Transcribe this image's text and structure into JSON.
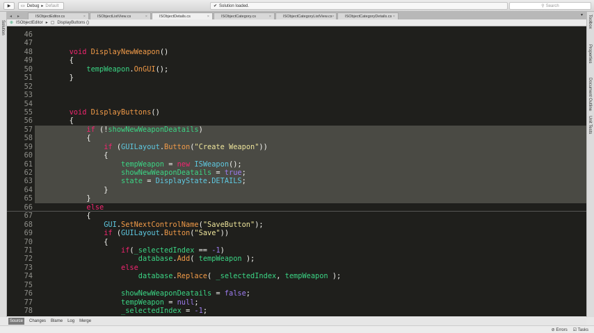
{
  "toolbar": {
    "run_icon": "play-icon",
    "config": "Debug",
    "separator": "▸",
    "target": "Default",
    "status": "Solution loaded.",
    "search_placeholder": "Search"
  },
  "tabs": [
    {
      "label": "ISObjectEditor.cs",
      "active": false
    },
    {
      "label": "ISObjectListView.cs",
      "active": false
    },
    {
      "label": "ISObjectDetails.cs",
      "active": true
    },
    {
      "label": "ISObjectCategory.cs",
      "active": false
    },
    {
      "label": "ISObjectCategoryListView.cs",
      "active": false
    },
    {
      "label": "ISObjectCategoryDetails.cs",
      "active": false
    }
  ],
  "breadcrumb": {
    "class": "ISObjectEditor",
    "sep": "▸",
    "method": "DisplayButtons ()"
  },
  "left_pad": {
    "solution": "Solution"
  },
  "right_pad": {
    "toolbox": "Toolbox",
    "properties": "Properties",
    "outline": "Document Outline",
    "unit_tests": "Unit Tests"
  },
  "editor": {
    "lines": [
      {
        "n": "46",
        "t": []
      },
      {
        "n": "47",
        "t": []
      },
      {
        "n": "48",
        "t": [
          [
            "        ",
            "pl"
          ],
          [
            "void ",
            "kw"
          ],
          [
            "DisplayNewWeapon",
            "fn"
          ],
          [
            "()",
            "pl"
          ]
        ]
      },
      {
        "n": "49",
        "t": [
          [
            "        {",
            "pl"
          ]
        ]
      },
      {
        "n": "50",
        "t": [
          [
            "            ",
            "pl"
          ],
          [
            "tempWeapon",
            "id"
          ],
          [
            ".",
            "pl"
          ],
          [
            "OnGUI",
            "fn"
          ],
          [
            "();",
            "pl"
          ]
        ]
      },
      {
        "n": "51",
        "t": [
          [
            "        }",
            "pl"
          ]
        ]
      },
      {
        "n": "52",
        "t": []
      },
      {
        "n": "53",
        "t": []
      },
      {
        "n": "54",
        "t": []
      },
      {
        "n": "55",
        "t": [
          [
            "        ",
            "pl"
          ],
          [
            "void ",
            "kw"
          ],
          [
            "DisplayButtons",
            "fn"
          ],
          [
            "()",
            "pl"
          ]
        ]
      },
      {
        "n": "56",
        "t": [
          [
            "        {",
            "pl"
          ]
        ]
      },
      {
        "n": "57",
        "hl": true,
        "t": [
          [
            "            ",
            "pl"
          ],
          [
            "if ",
            "kw"
          ],
          [
            "(!",
            "pl"
          ],
          [
            "showNewWeaponDeatails",
            "id"
          ],
          [
            ")",
            "pl"
          ]
        ]
      },
      {
        "n": "58",
        "hl": true,
        "t": [
          [
            "            {",
            "pl"
          ]
        ]
      },
      {
        "n": "59",
        "hl": true,
        "t": [
          [
            "                ",
            "pl"
          ],
          [
            "if ",
            "kw"
          ],
          [
            "(",
            "pl"
          ],
          [
            "GUILayout",
            "ty"
          ],
          [
            ".",
            "pl"
          ],
          [
            "Button",
            "fn"
          ],
          [
            "(",
            "pl"
          ],
          [
            "\"Create Weapon\"",
            "st"
          ],
          [
            "))",
            "pl"
          ]
        ]
      },
      {
        "n": "60",
        "hl": true,
        "t": [
          [
            "                {",
            "pl"
          ]
        ]
      },
      {
        "n": "61",
        "hl": true,
        "t": [
          [
            "                    ",
            "pl"
          ],
          [
            "tempWeapon",
            "id"
          ],
          [
            " = ",
            "pl"
          ],
          [
            "new ",
            "kw"
          ],
          [
            "ISWeapon",
            "ty"
          ],
          [
            "();",
            "pl"
          ]
        ]
      },
      {
        "n": "62",
        "hl": true,
        "t": [
          [
            "                    ",
            "pl"
          ],
          [
            "showNewWeaponDeatails",
            "id"
          ],
          [
            " = ",
            "pl"
          ],
          [
            "true",
            "cn"
          ],
          [
            ";",
            "pl"
          ]
        ]
      },
      {
        "n": "63",
        "hl": true,
        "t": [
          [
            "                    ",
            "pl"
          ],
          [
            "state",
            "id"
          ],
          [
            " = ",
            "pl"
          ],
          [
            "DisplayState",
            "ty"
          ],
          [
            ".",
            "pl"
          ],
          [
            "DETAILS",
            "ty"
          ],
          [
            ";",
            "pl"
          ]
        ]
      },
      {
        "n": "64",
        "hl": true,
        "t": [
          [
            "                }",
            "pl"
          ]
        ]
      },
      {
        "n": "65",
        "hl": true,
        "t": [
          [
            "            }",
            "pl"
          ]
        ]
      },
      {
        "n": "66",
        "cur": true,
        "t": [
          [
            "            ",
            "pl"
          ],
          [
            "else",
            "kw"
          ]
        ]
      },
      {
        "n": "67",
        "t": [
          [
            "            {",
            "pl"
          ]
        ]
      },
      {
        "n": "68",
        "t": [
          [
            "                ",
            "pl"
          ],
          [
            "GUI",
            "ty"
          ],
          [
            ".",
            "pl"
          ],
          [
            "SetNextControlName",
            "fn"
          ],
          [
            "(",
            "pl"
          ],
          [
            "\"SaveButton\"",
            "st"
          ],
          [
            ");",
            "pl"
          ]
        ]
      },
      {
        "n": "69",
        "t": [
          [
            "                ",
            "pl"
          ],
          [
            "if ",
            "kw"
          ],
          [
            "(",
            "pl"
          ],
          [
            "GUILayout",
            "ty"
          ],
          [
            ".",
            "pl"
          ],
          [
            "Button",
            "fn"
          ],
          [
            "(",
            "pl"
          ],
          [
            "\"Save\"",
            "st"
          ],
          [
            "))",
            "pl"
          ]
        ]
      },
      {
        "n": "70",
        "t": [
          [
            "                {",
            "pl"
          ]
        ]
      },
      {
        "n": "71",
        "t": [
          [
            "                    ",
            "pl"
          ],
          [
            "if",
            "kw"
          ],
          [
            "(",
            "pl"
          ],
          [
            "_selectedIndex",
            "id"
          ],
          [
            " == ",
            "pl"
          ],
          [
            "-1",
            "cn"
          ],
          [
            ")",
            "pl"
          ]
        ]
      },
      {
        "n": "72",
        "t": [
          [
            "                        ",
            "pl"
          ],
          [
            "database",
            "id"
          ],
          [
            ".",
            "pl"
          ],
          [
            "Add",
            "fn"
          ],
          [
            "( ",
            "pl"
          ],
          [
            "tempWeapon",
            "id"
          ],
          [
            " );",
            "pl"
          ]
        ]
      },
      {
        "n": "73",
        "t": [
          [
            "                    ",
            "pl"
          ],
          [
            "else",
            "kw"
          ]
        ]
      },
      {
        "n": "74",
        "t": [
          [
            "                        ",
            "pl"
          ],
          [
            "database",
            "id"
          ],
          [
            ".",
            "pl"
          ],
          [
            "Replace",
            "fn"
          ],
          [
            "( ",
            "pl"
          ],
          [
            "_selectedIndex",
            "id"
          ],
          [
            ", ",
            "pl"
          ],
          [
            "tempWeapon",
            "id"
          ],
          [
            " );",
            "pl"
          ]
        ]
      },
      {
        "n": "75",
        "t": []
      },
      {
        "n": "76",
        "t": [
          [
            "                    ",
            "pl"
          ],
          [
            "showNewWeaponDeatails",
            "id"
          ],
          [
            " = ",
            "pl"
          ],
          [
            "false",
            "cn"
          ],
          [
            ";",
            "pl"
          ]
        ]
      },
      {
        "n": "77",
        "t": [
          [
            "                    ",
            "pl"
          ],
          [
            "tempWeapon",
            "id"
          ],
          [
            " = ",
            "pl"
          ],
          [
            "null",
            "cn"
          ],
          [
            ";",
            "pl"
          ]
        ]
      },
      {
        "n": "78",
        "t": [
          [
            "                    ",
            "pl"
          ],
          [
            "_selectedIndex",
            "id"
          ],
          [
            " = ",
            "pl"
          ],
          [
            "-1",
            "cn"
          ],
          [
            ";",
            "pl"
          ]
        ]
      }
    ]
  },
  "bottom_tabs": [
    {
      "label": "Source",
      "active": true
    },
    {
      "label": "Changes"
    },
    {
      "label": "Blame"
    },
    {
      "label": "Log"
    },
    {
      "label": "Merge"
    }
  ],
  "statusbar": {
    "errors": "Errors",
    "tasks": "Tasks"
  }
}
